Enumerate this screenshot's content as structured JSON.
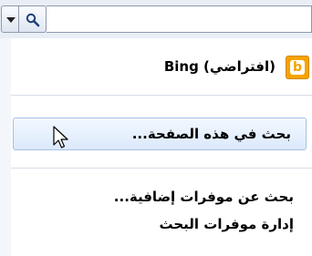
{
  "toolbar": {
    "dropdown_icon": "chevron-down-icon",
    "search_icon": "search-icon"
  },
  "menu": {
    "default_provider": "Bing (افتراضي)",
    "default_provider_icon": "bing-logo-icon",
    "items": [
      {
        "label": "بحث في هذه الصفحة..."
      },
      {
        "label": "بحث عن موفرات إضافية..."
      },
      {
        "label": "إدارة موفرات البحث"
      }
    ]
  },
  "colors": {
    "bing_orange": "#f6a300",
    "highlight_border": "#a7c1e2",
    "toolbar_bg": "#e9eef6"
  }
}
